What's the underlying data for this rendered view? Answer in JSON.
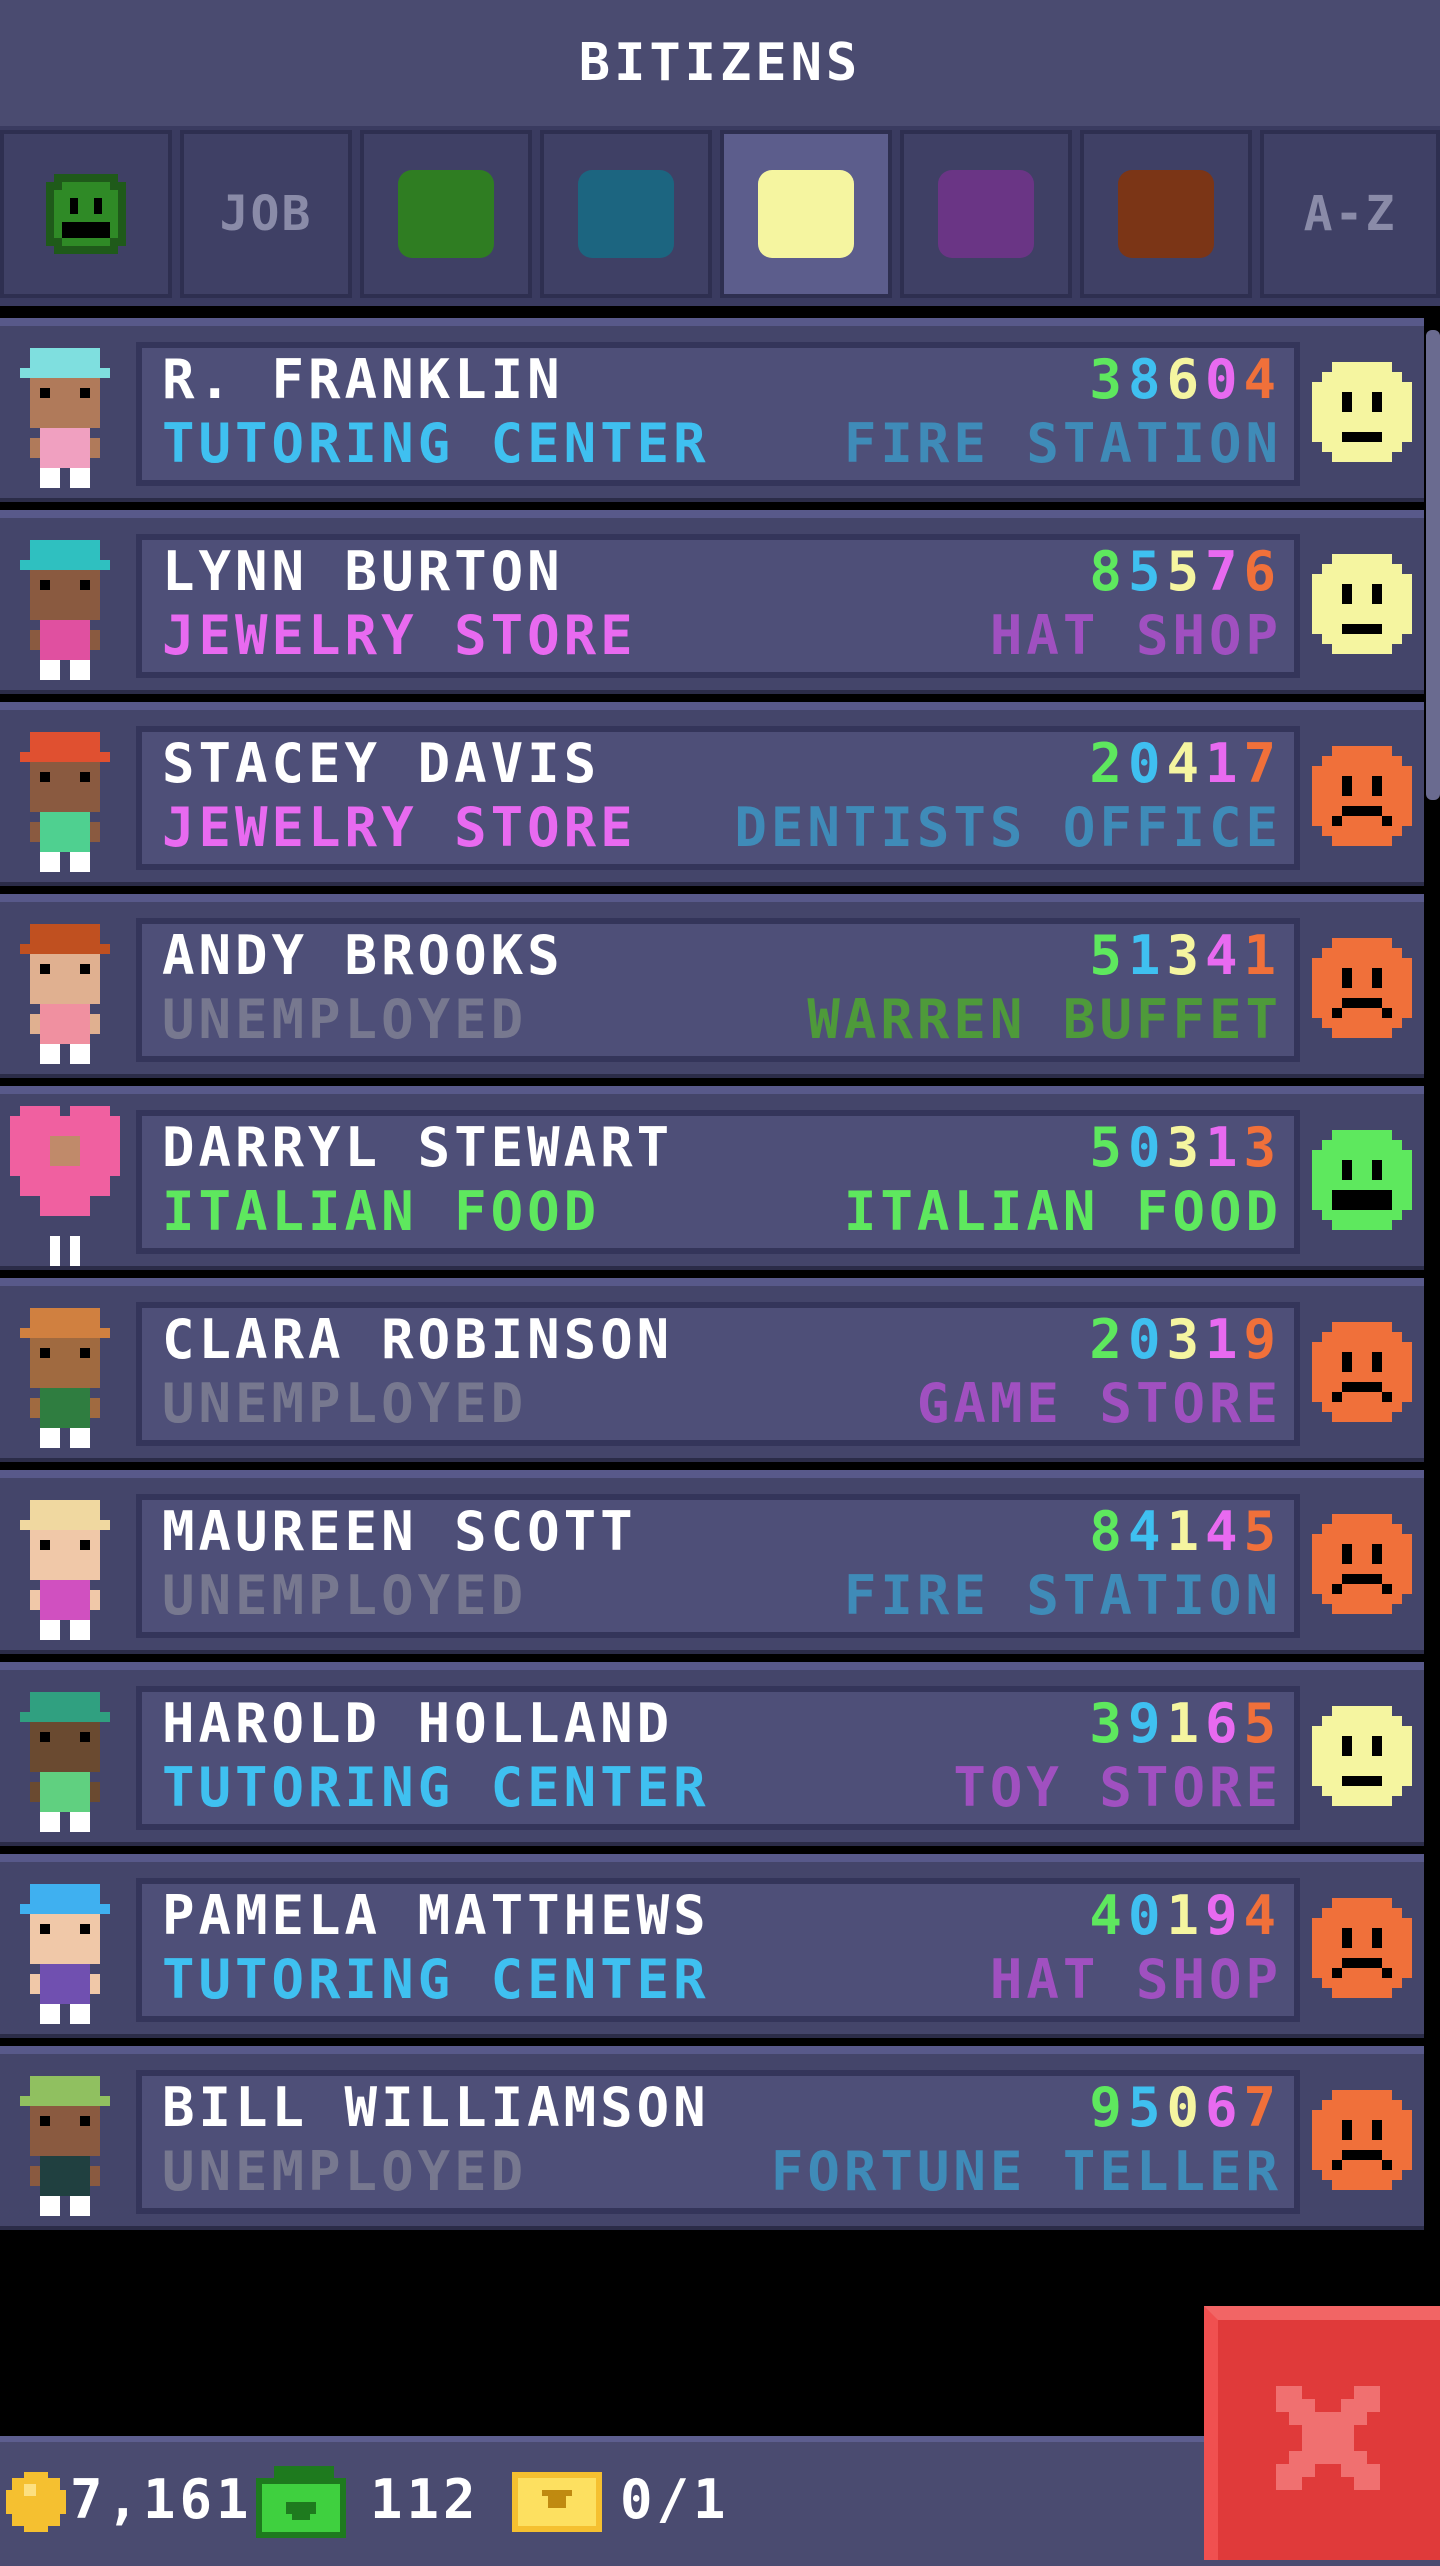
{
  "header": {
    "title": "BITIZENS"
  },
  "tabs": {
    "job_label": "JOB",
    "az_label": "A-Z",
    "swatch_colors": [
      "#2f7d22",
      "#1c6580",
      "#f5f5a0",
      "#6a3585",
      "#7b3516"
    ],
    "selected_index": 4
  },
  "bitizens": [
    {
      "name": "R. FRANKLIN",
      "job": "TUTORING CENTER",
      "job_color": "#3fc0f0",
      "dream": "FIRE STATION",
      "dream_color": "#3f8bb8",
      "stats": "38604",
      "mood": "neutral"
    },
    {
      "name": "LYNN BURTON",
      "job": "JEWELRY STORE",
      "job_color": "#e86af0",
      "dream": "HAT SHOP",
      "dream_color": "#a050c0",
      "stats": "85576",
      "mood": "neutral"
    },
    {
      "name": "STACEY DAVIS",
      "job": "JEWELRY STORE",
      "job_color": "#e86af0",
      "dream": "DENTISTS OFFICE",
      "dream_color": "#3f8bb8",
      "stats": "20417",
      "mood": "sad"
    },
    {
      "name": "ANDY BROOKS",
      "job": "UNEMPLOYED",
      "job_color": "#77788f",
      "dream": "WARREN BUFFET",
      "dream_color": "#4e9a3a",
      "stats": "51341",
      "mood": "sad"
    },
    {
      "name": "DARRYL STEWART",
      "job": "ITALIAN FOOD",
      "job_color": "#5ee85e",
      "dream": "ITALIAN FOOD",
      "dream_color": "#5ee85e",
      "stats": "50313",
      "mood": "happy"
    },
    {
      "name": "CLARA ROBINSON",
      "job": "UNEMPLOYED",
      "job_color": "#77788f",
      "dream": "GAME STORE",
      "dream_color": "#a050c0",
      "stats": "20319",
      "mood": "sad"
    },
    {
      "name": "MAUREEN SCOTT",
      "job": "UNEMPLOYED",
      "job_color": "#77788f",
      "dream": "FIRE STATION",
      "dream_color": "#3f8bb8",
      "stats": "84145",
      "mood": "sad"
    },
    {
      "name": "HAROLD HOLLAND",
      "job": "TUTORING CENTER",
      "job_color": "#3fc0f0",
      "dream": "TOY STORE",
      "dream_color": "#a050c0",
      "stats": "39165",
      "mood": "neutral"
    },
    {
      "name": "PAMELA MATTHEWS",
      "job": "TUTORING CENTER",
      "job_color": "#3fc0f0",
      "dream": "HAT SHOP",
      "dream_color": "#a050c0",
      "stats": "40194",
      "mood": "sad"
    },
    {
      "name": "BILL WILLIAMSON",
      "job": "UNEMPLOYED",
      "job_color": "#77788f",
      "dream": "FORTUNE TELLER",
      "dream_color": "#3f8bb8",
      "stats": "95067",
      "mood": "sad"
    }
  ],
  "stat_colors": [
    "#5ee85e",
    "#3fc0f0",
    "#f5f5a0",
    "#e86af0",
    "#f0703a"
  ],
  "mood_colors": {
    "happy": "#5ee85e",
    "neutral": "#f5f5a0",
    "sad": "#f0703a"
  },
  "avatar_colors": [
    {
      "hair": "#7fdfdf",
      "skin": "#b07a5a",
      "shirt": "#f0a0c0"
    },
    {
      "hair": "#2fc0c0",
      "skin": "#8a5a40",
      "shirt": "#e050a0"
    },
    {
      "hair": "#e05030",
      "skin": "#8a5a40",
      "shirt": "#4fd090"
    },
    {
      "hair": "#c05020",
      "skin": "#e0b090",
      "shirt": "#f090a0"
    },
    {
      "hair": "#f060a0",
      "skin": "#c08a6a",
      "shirt": "#f060a0"
    },
    {
      "hair": "#d08040",
      "skin": "#a06a40",
      "shirt": "#2f7d40"
    },
    {
      "hair": "#f0d8a0",
      "skin": "#f0c8a8",
      "shirt": "#d050c0"
    },
    {
      "hair": "#30a080",
      "skin": "#6a4a30",
      "shirt": "#60d080"
    },
    {
      "hair": "#3fb0f0",
      "skin": "#f0c8a8",
      "shirt": "#7050b0"
    },
    {
      "hair": "#90c060",
      "skin": "#8a5a40",
      "shirt": "#204040"
    }
  ],
  "footer": {
    "coins": "7,161",
    "bux": "112",
    "tickets": "0/1"
  }
}
